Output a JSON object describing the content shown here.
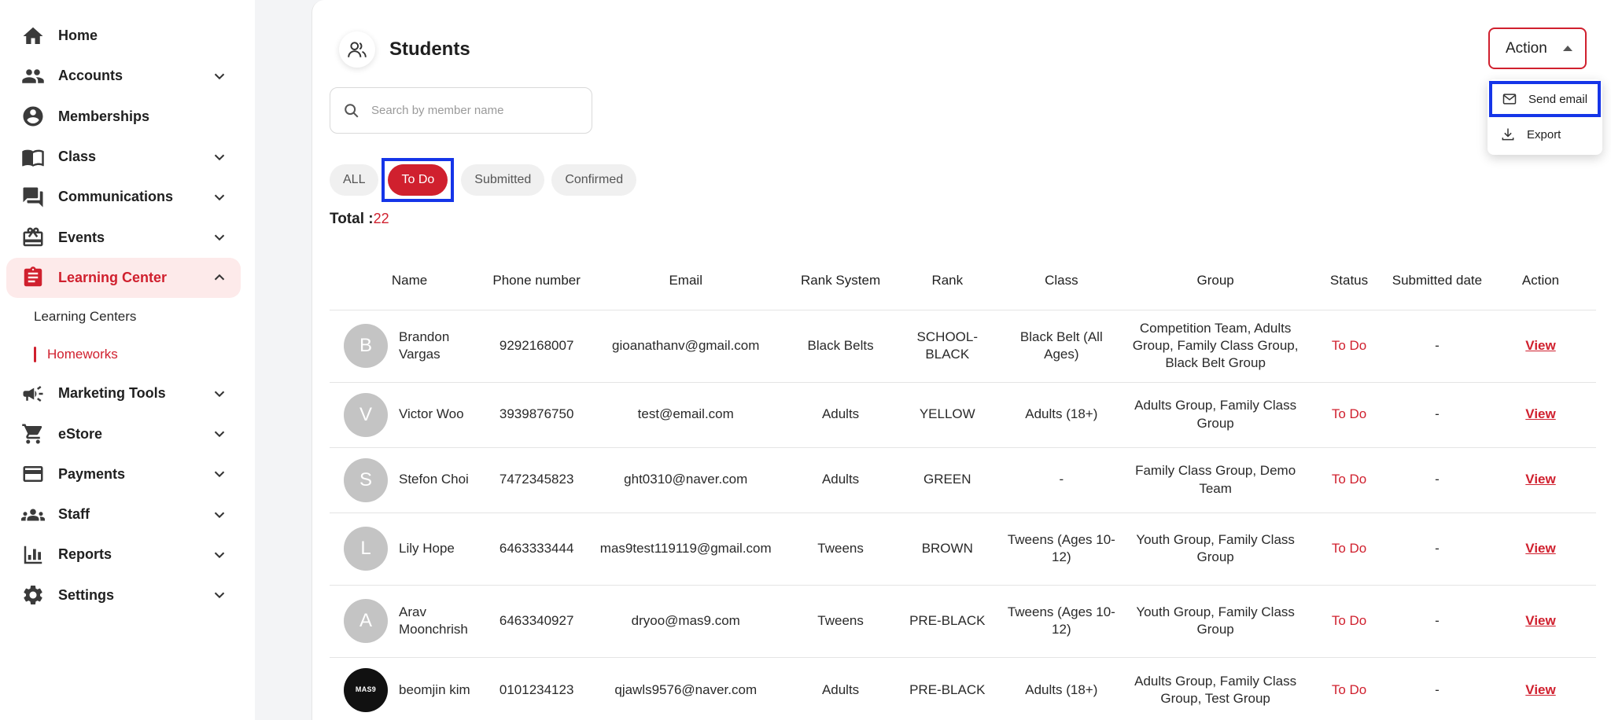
{
  "sidebar": {
    "items": [
      {
        "label": "Home"
      },
      {
        "label": "Accounts"
      },
      {
        "label": "Memberships"
      },
      {
        "label": "Class"
      },
      {
        "label": "Communications"
      },
      {
        "label": "Events"
      },
      {
        "label": "Learning Center"
      },
      {
        "label": "Marketing Tools"
      },
      {
        "label": "eStore"
      },
      {
        "label": "Payments"
      },
      {
        "label": "Staff"
      },
      {
        "label": "Reports"
      },
      {
        "label": "Settings"
      }
    ],
    "learning_center_sub": [
      {
        "label": "Learning Centers"
      },
      {
        "label": "Homeworks"
      }
    ]
  },
  "header": {
    "title": "Students",
    "action_label": "Action"
  },
  "action_menu": {
    "send_email": "Send email",
    "export": "Export"
  },
  "search": {
    "placeholder": "Search by member name",
    "value": ""
  },
  "filters": [
    "ALL",
    "To Do",
    "Submitted",
    "Confirmed"
  ],
  "active_filter": "To Do",
  "total": {
    "label": "Total :",
    "count": "22"
  },
  "table": {
    "columns": [
      "Name",
      "Phone number",
      "Email",
      "Rank System",
      "Rank",
      "Class",
      "Group",
      "Status",
      "Submitted date",
      "Action"
    ],
    "rows": [
      {
        "initial": "B",
        "name": "Brandon Vargas",
        "phone": "9292168007",
        "email": "gioanathanv@gmail.com",
        "rank_system": "Black Belts",
        "rank": "SCHOOL-BLACK",
        "class": "Black Belt (All Ages)",
        "group": "Competition Team, Adults Group, Family Class Group, Black Belt Group",
        "status": "To Do",
        "submitted": "-",
        "action": "View"
      },
      {
        "initial": "V",
        "name": "Victor Woo",
        "phone": "3939876750",
        "email": "test@email.com",
        "rank_system": "Adults",
        "rank": "YELLOW",
        "class": "Adults (18+)",
        "group": "Adults Group, Family Class Group",
        "status": "To Do",
        "submitted": "-",
        "action": "View"
      },
      {
        "initial": "S",
        "name": "Stefon Choi",
        "phone": "7472345823",
        "email": "ght0310@naver.com",
        "rank_system": "Adults",
        "rank": "GREEN",
        "class": "-",
        "group": "Family Class Group, Demo Team",
        "status": "To Do",
        "submitted": "-",
        "action": "View"
      },
      {
        "initial": "L",
        "name": "Lily Hope",
        "phone": "6463333444",
        "email": "mas9test119119@gmail.com",
        "rank_system": "Tweens",
        "rank": "BROWN",
        "class": "Tweens (Ages 10-12)",
        "group": "Youth Group, Family Class Group",
        "status": "To Do",
        "submitted": "-",
        "action": "View"
      },
      {
        "initial": "A",
        "name": "Arav Moonchrish",
        "phone": "6463340927",
        "email": "dryoo@mas9.com",
        "rank_system": "Tweens",
        "rank": "PRE-BLACK",
        "class": "Tweens (Ages 10-12)",
        "group": "Youth Group, Family Class Group",
        "status": "To Do",
        "submitted": "-",
        "action": "View"
      },
      {
        "initial": "MAS9",
        "name": "beomjin kim",
        "phone": "0101234123",
        "email": "qjawls9576@naver.com",
        "rank_system": "Adults",
        "rank": "PRE-BLACK",
        "class": "Adults (18+)",
        "group": "Adults Group, Family Class Group, Test Group",
        "status": "To Do",
        "submitted": "-",
        "action": "View"
      }
    ]
  },
  "colors": {
    "accent": "#d0202e",
    "highlight": "#1535e8",
    "active_bg": "#fdeaea"
  }
}
